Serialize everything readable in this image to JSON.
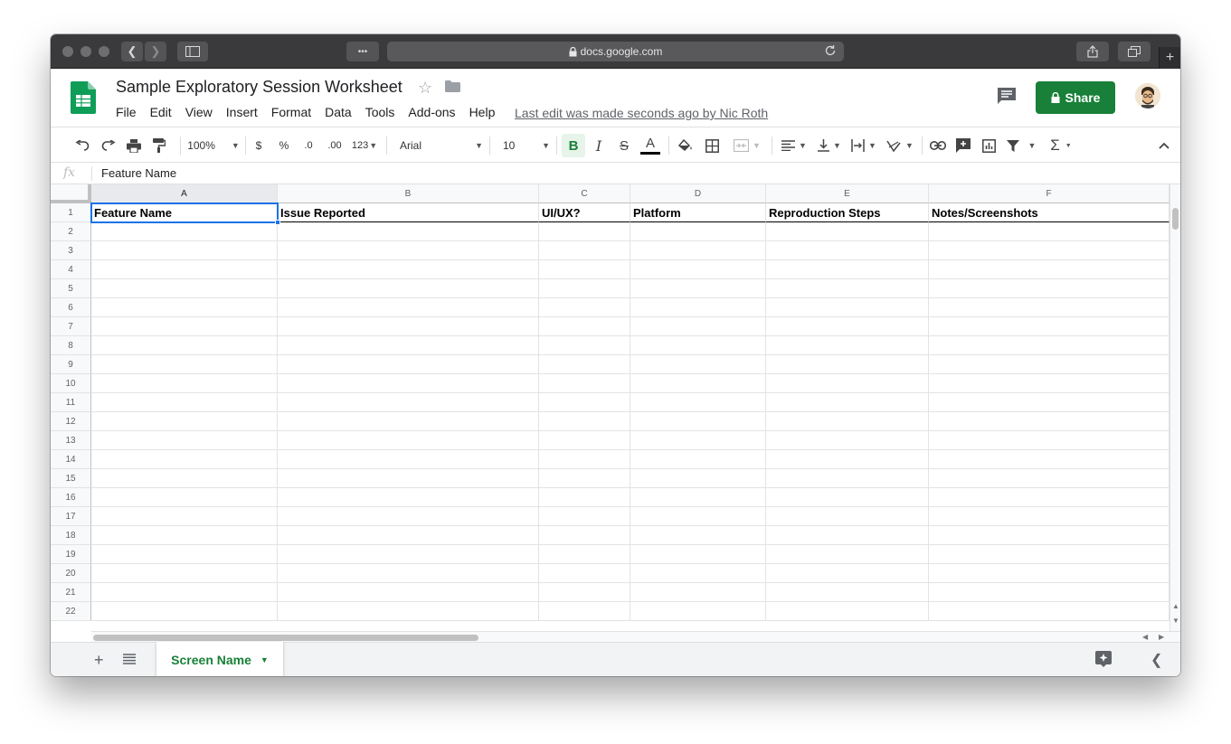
{
  "browser": {
    "url": "docs.google.com",
    "lock_icon": "lock-icon",
    "more_label": "•••"
  },
  "doc": {
    "title": "Sample Exploratory Session Worksheet",
    "menu": [
      "File",
      "Edit",
      "View",
      "Insert",
      "Format",
      "Data",
      "Tools",
      "Add-ons",
      "Help"
    ],
    "last_edit": "Last edit was made seconds ago by Nic Roth",
    "share_label": "Share"
  },
  "toolbar": {
    "zoom": "100%",
    "currency": "$",
    "percent": "%",
    "decrease_decimal": ".0",
    "increase_decimal": ".00",
    "more_formats": "123",
    "font": "Arial",
    "font_size": "10",
    "bold": "B",
    "italic": "I",
    "strike": "S",
    "text_color": "A",
    "sum": "Σ"
  },
  "formula_bar": {
    "fx": "fx",
    "value": "Feature Name"
  },
  "grid": {
    "columns": [
      "A",
      "B",
      "C",
      "D",
      "E",
      "F"
    ],
    "rows": [
      "1",
      "2",
      "3",
      "4",
      "5",
      "6",
      "7",
      "8",
      "9",
      "10",
      "11",
      "12",
      "13",
      "14",
      "15",
      "16",
      "17",
      "18",
      "19",
      "20",
      "21",
      "22"
    ],
    "header_row": [
      "Feature Name",
      "Issue Reported",
      "UI/UX?",
      "Platform",
      "Reproduction Steps",
      "Notes/Screenshots"
    ]
  },
  "sheets": {
    "active": "Screen Name"
  },
  "colors": {
    "accent_green": "#188038",
    "selection_blue": "#1a73e8"
  }
}
